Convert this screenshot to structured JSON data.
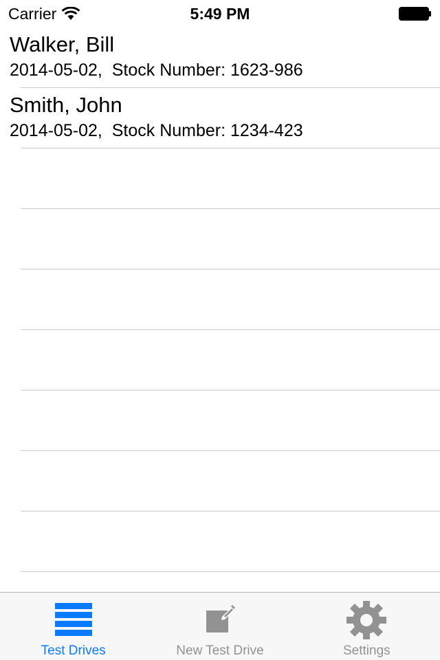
{
  "status_bar": {
    "carrier": "Carrier",
    "time": "5:49 PM"
  },
  "test_drives": [
    {
      "name": "Walker, Bill",
      "detail": "2014-05-02,  Stock Number: 1623-986"
    },
    {
      "name": "Smith, John",
      "detail": "2014-05-02,  Stock Number: 1234-423"
    }
  ],
  "tab_bar": {
    "tabs": [
      {
        "label": "Test Drives",
        "icon": "list-icon",
        "active": true
      },
      {
        "label": "New Test Drive",
        "icon": "compose-icon",
        "active": false
      },
      {
        "label": "Settings",
        "icon": "gear-icon",
        "active": false
      }
    ]
  },
  "colors": {
    "accent": "#0a7aff",
    "inactive": "#929292",
    "separator": "#c8c7cc",
    "tab_bar_bg": "#f7f7f7"
  }
}
